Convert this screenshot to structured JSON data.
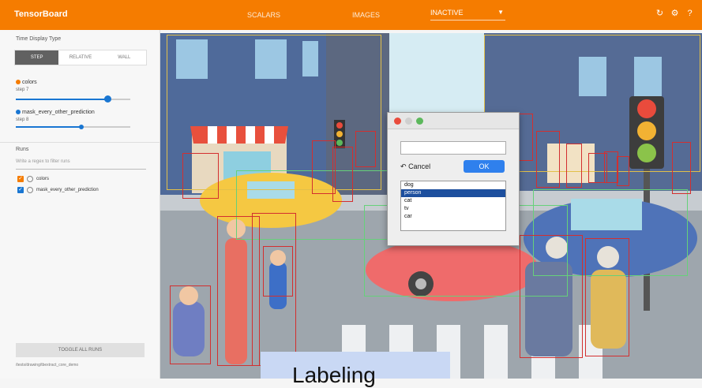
{
  "topbar": {
    "brand": "TensorBoard",
    "tabs": [
      "SCALARS",
      "IMAGES"
    ],
    "dropdown": "INACTIVE",
    "icons": [
      "refresh-icon",
      "gear-icon",
      "help-icon"
    ],
    "color": "#f57c00"
  },
  "sidebar": {
    "time_display_title": "Time Display Type",
    "time_display_options": [
      "STEP",
      "RELATIVE",
      "WALL"
    ],
    "runs_image": [
      {
        "name": "colors",
        "step_label": "step 7",
        "color": "#f57c00",
        "progress": 0.8
      },
      {
        "name": "mask_every_other_prediction",
        "step_label": "step 8",
        "color": "#1976d2",
        "progress": 0.58
      }
    ],
    "runs_title": "Runs",
    "filter_placeholder": "Write a regex to filter runs",
    "runs": [
      {
        "name": "colors",
        "color": "#f57c00"
      },
      {
        "name": "mask_every_other_prediction",
        "color": "#1976d2"
      }
    ],
    "toggle_label": "TOGGLE ALL RUNS",
    "footer": "/tests/drawing/tbextract_core_demo"
  },
  "dialog": {
    "cancel_label": "Cancel",
    "ok_label": "OK",
    "list": [
      "dog",
      "person",
      "cat",
      "tv",
      "car"
    ],
    "selected_index": 1
  },
  "overlay": {
    "text": "Labeling"
  }
}
